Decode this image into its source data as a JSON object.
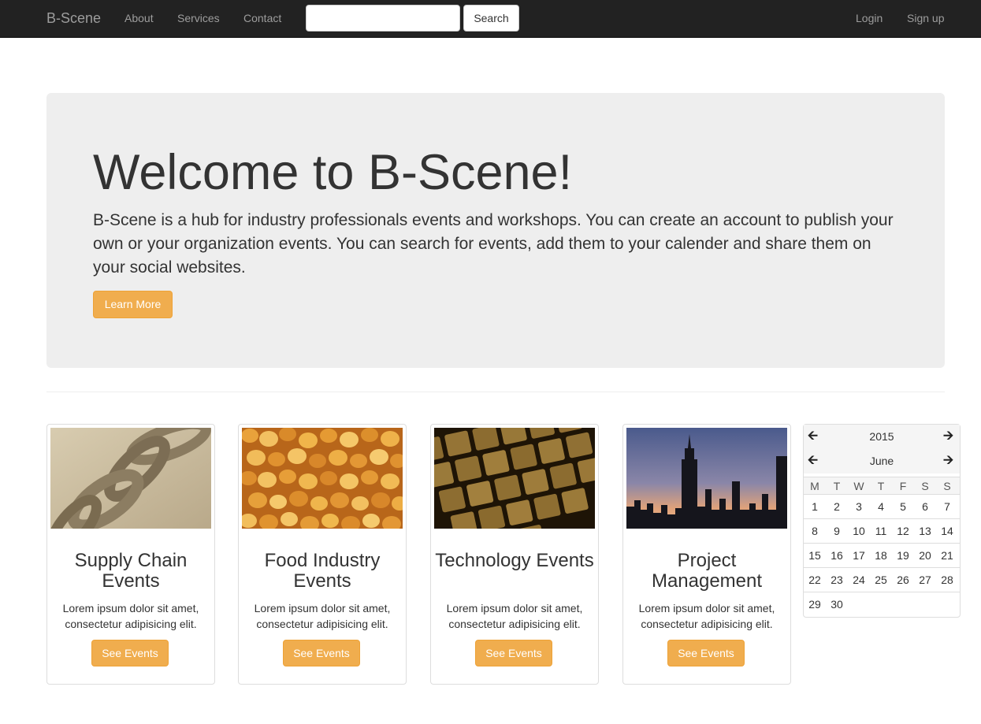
{
  "navbar": {
    "brand": "B-Scene",
    "links": [
      "About",
      "Services",
      "Contact"
    ],
    "search": {
      "value": "",
      "button": "Search"
    },
    "right_links": [
      "Login",
      "Sign up"
    ]
  },
  "jumbotron": {
    "title": "Welcome to B-Scene!",
    "text": "B-Scene is a hub for industry professionals events and workshops. You can create an account to publish your own or your organization events. You can search for events, add them to your calender and share them on your social websites.",
    "button": "Learn More"
  },
  "cards": [
    {
      "title": "Supply Chain Events",
      "text": "Lorem ipsum dolor sit amet, consectetur adipisicing elit.",
      "button": "See Events",
      "image": "chain-image"
    },
    {
      "title": "Food Industry Events",
      "text": "Lorem ipsum dolor sit amet, consectetur adipisicing elit.",
      "button": "See Events",
      "image": "corn-kernels-image"
    },
    {
      "title": "Technology Events",
      "text": "Lorem ipsum dolor sit amet, consectetur adipisicing elit.",
      "button": "See Events",
      "image": "keyboard-image"
    },
    {
      "title": "Project Management",
      "text": "Lorem ipsum dolor sit amet, consectetur adipisicing elit.",
      "button": "See Events",
      "image": "city-skyline-image"
    }
  ],
  "calendar": {
    "year": "2015",
    "month": "June",
    "weekdays": [
      "M",
      "T",
      "W",
      "T",
      "F",
      "S",
      "S"
    ],
    "weeks": [
      [
        "1",
        "2",
        "3",
        "4",
        "5",
        "6",
        "7"
      ],
      [
        "8",
        "9",
        "10",
        "11",
        "12",
        "13",
        "14"
      ],
      [
        "15",
        "16",
        "17",
        "18",
        "19",
        "20",
        "21"
      ],
      [
        "22",
        "23",
        "24",
        "25",
        "26",
        "27",
        "28"
      ],
      [
        "29",
        "30",
        "",
        "",
        "",
        "",
        ""
      ]
    ],
    "prev_icon": "arrow-left-icon",
    "next_icon": "arrow-right-icon"
  },
  "colors": {
    "navbar": "#222222",
    "nav_text": "#9d9d9d",
    "jumbotron": "#eeeeee",
    "warning_button": "#f0ad4e"
  }
}
